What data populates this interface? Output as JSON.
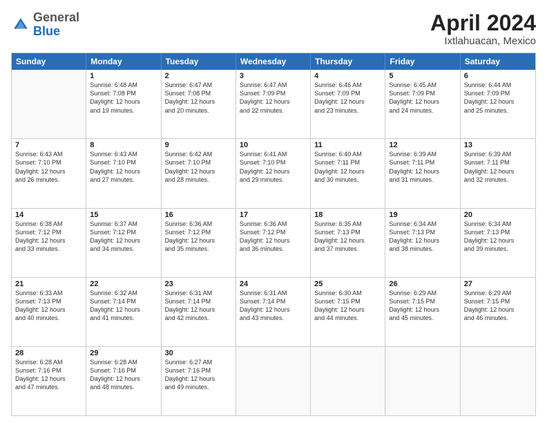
{
  "header": {
    "logo_general": "General",
    "logo_blue": "Blue",
    "main_title": "April 2024",
    "subtitle": "Ixtlahuacan, Mexico"
  },
  "calendar": {
    "days_of_week": [
      "Sunday",
      "Monday",
      "Tuesday",
      "Wednesday",
      "Thursday",
      "Friday",
      "Saturday"
    ],
    "rows": [
      [
        {
          "day": "",
          "empty": true
        },
        {
          "day": "1",
          "line1": "Sunrise: 6:48 AM",
          "line2": "Sunset: 7:08 PM",
          "line3": "Daylight: 12 hours",
          "line4": "and 19 minutes."
        },
        {
          "day": "2",
          "line1": "Sunrise: 6:47 AM",
          "line2": "Sunset: 7:08 PM",
          "line3": "Daylight: 12 hours",
          "line4": "and 20 minutes."
        },
        {
          "day": "3",
          "line1": "Sunrise: 6:47 AM",
          "line2": "Sunset: 7:09 PM",
          "line3": "Daylight: 12 hours",
          "line4": "and 22 minutes."
        },
        {
          "day": "4",
          "line1": "Sunrise: 6:46 AM",
          "line2": "Sunset: 7:09 PM",
          "line3": "Daylight: 12 hours",
          "line4": "and 23 minutes."
        },
        {
          "day": "5",
          "line1": "Sunrise: 6:45 AM",
          "line2": "Sunset: 7:09 PM",
          "line3": "Daylight: 12 hours",
          "line4": "and 24 minutes."
        },
        {
          "day": "6",
          "line1": "Sunrise: 6:44 AM",
          "line2": "Sunset: 7:09 PM",
          "line3": "Daylight: 12 hours",
          "line4": "and 25 minutes."
        }
      ],
      [
        {
          "day": "7",
          "line1": "Sunrise: 6:43 AM",
          "line2": "Sunset: 7:10 PM",
          "line3": "Daylight: 12 hours",
          "line4": "and 26 minutes."
        },
        {
          "day": "8",
          "line1": "Sunrise: 6:43 AM",
          "line2": "Sunset: 7:10 PM",
          "line3": "Daylight: 12 hours",
          "line4": "and 27 minutes."
        },
        {
          "day": "9",
          "line1": "Sunrise: 6:42 AM",
          "line2": "Sunset: 7:10 PM",
          "line3": "Daylight: 12 hours",
          "line4": "and 28 minutes."
        },
        {
          "day": "10",
          "line1": "Sunrise: 6:41 AM",
          "line2": "Sunset: 7:10 PM",
          "line3": "Daylight: 12 hours",
          "line4": "and 29 minutes."
        },
        {
          "day": "11",
          "line1": "Sunrise: 6:40 AM",
          "line2": "Sunset: 7:11 PM",
          "line3": "Daylight: 12 hours",
          "line4": "and 30 minutes."
        },
        {
          "day": "12",
          "line1": "Sunrise: 6:39 AM",
          "line2": "Sunset: 7:11 PM",
          "line3": "Daylight: 12 hours",
          "line4": "and 31 minutes."
        },
        {
          "day": "13",
          "line1": "Sunrise: 6:39 AM",
          "line2": "Sunset: 7:11 PM",
          "line3": "Daylight: 12 hours",
          "line4": "and 32 minutes."
        }
      ],
      [
        {
          "day": "14",
          "line1": "Sunrise: 6:38 AM",
          "line2": "Sunset: 7:12 PM",
          "line3": "Daylight: 12 hours",
          "line4": "and 33 minutes."
        },
        {
          "day": "15",
          "line1": "Sunrise: 6:37 AM",
          "line2": "Sunset: 7:12 PM",
          "line3": "Daylight: 12 hours",
          "line4": "and 34 minutes."
        },
        {
          "day": "16",
          "line1": "Sunrise: 6:36 AM",
          "line2": "Sunset: 7:12 PM",
          "line3": "Daylight: 12 hours",
          "line4": "and 35 minutes."
        },
        {
          "day": "17",
          "line1": "Sunrise: 6:36 AM",
          "line2": "Sunset: 7:12 PM",
          "line3": "Daylight: 12 hours",
          "line4": "and 36 minutes."
        },
        {
          "day": "18",
          "line1": "Sunrise: 6:35 AM",
          "line2": "Sunset: 7:13 PM",
          "line3": "Daylight: 12 hours",
          "line4": "and 37 minutes."
        },
        {
          "day": "19",
          "line1": "Sunrise: 6:34 AM",
          "line2": "Sunset: 7:13 PM",
          "line3": "Daylight: 12 hours",
          "line4": "and 38 minutes."
        },
        {
          "day": "20",
          "line1": "Sunrise: 6:34 AM",
          "line2": "Sunset: 7:13 PM",
          "line3": "Daylight: 12 hours",
          "line4": "and 39 minutes."
        }
      ],
      [
        {
          "day": "21",
          "line1": "Sunrise: 6:33 AM",
          "line2": "Sunset: 7:13 PM",
          "line3": "Daylight: 12 hours",
          "line4": "and 40 minutes."
        },
        {
          "day": "22",
          "line1": "Sunrise: 6:32 AM",
          "line2": "Sunset: 7:14 PM",
          "line3": "Daylight: 12 hours",
          "line4": "and 41 minutes."
        },
        {
          "day": "23",
          "line1": "Sunrise: 6:31 AM",
          "line2": "Sunset: 7:14 PM",
          "line3": "Daylight: 12 hours",
          "line4": "and 42 minutes."
        },
        {
          "day": "24",
          "line1": "Sunrise: 6:31 AM",
          "line2": "Sunset: 7:14 PM",
          "line3": "Daylight: 12 hours",
          "line4": "and 43 minutes."
        },
        {
          "day": "25",
          "line1": "Sunrise: 6:30 AM",
          "line2": "Sunset: 7:15 PM",
          "line3": "Daylight: 12 hours",
          "line4": "and 44 minutes."
        },
        {
          "day": "26",
          "line1": "Sunrise: 6:29 AM",
          "line2": "Sunset: 7:15 PM",
          "line3": "Daylight: 12 hours",
          "line4": "and 45 minutes."
        },
        {
          "day": "27",
          "line1": "Sunrise: 6:29 AM",
          "line2": "Sunset: 7:15 PM",
          "line3": "Daylight: 12 hours",
          "line4": "and 46 minutes."
        }
      ],
      [
        {
          "day": "28",
          "line1": "Sunrise: 6:28 AM",
          "line2": "Sunset: 7:16 PM",
          "line3": "Daylight: 12 hours",
          "line4": "and 47 minutes."
        },
        {
          "day": "29",
          "line1": "Sunrise: 6:28 AM",
          "line2": "Sunset: 7:16 PM",
          "line3": "Daylight: 12 hours",
          "line4": "and 48 minutes."
        },
        {
          "day": "30",
          "line1": "Sunrise: 6:27 AM",
          "line2": "Sunset: 7:16 PM",
          "line3": "Daylight: 12 hours",
          "line4": "and 49 minutes."
        },
        {
          "day": "",
          "empty": true
        },
        {
          "day": "",
          "empty": true
        },
        {
          "day": "",
          "empty": true
        },
        {
          "day": "",
          "empty": true
        }
      ]
    ]
  }
}
